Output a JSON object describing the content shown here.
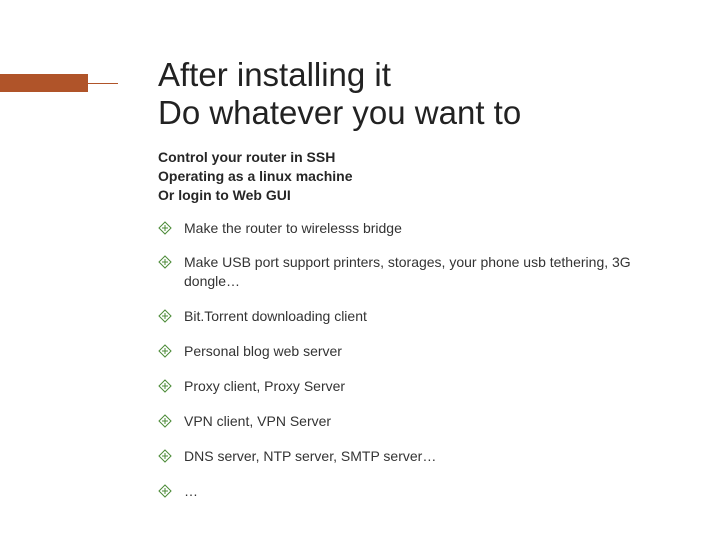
{
  "title_line1": "After installing it",
  "title_line2": "Do whatever you want to",
  "sub_line1": "Control your router in SSH",
  "sub_line2": "Operating as a linux machine",
  "sub_line3": "Or login to Web GUI",
  "bullets": [
    "Make the router to wirelesss bridge",
    "Make USB port support printers, storages, your phone usb tethering, 3G dongle…",
    "Bit.Torrent downloading client",
    "Personal blog web server",
    "Proxy client, Proxy Server",
    "VPN client, VPN Server",
    "DNS server, NTP server, SMTP server…",
    "…"
  ],
  "colors": {
    "accent": "#b05429",
    "bullet_icon": "#4a8a36"
  }
}
